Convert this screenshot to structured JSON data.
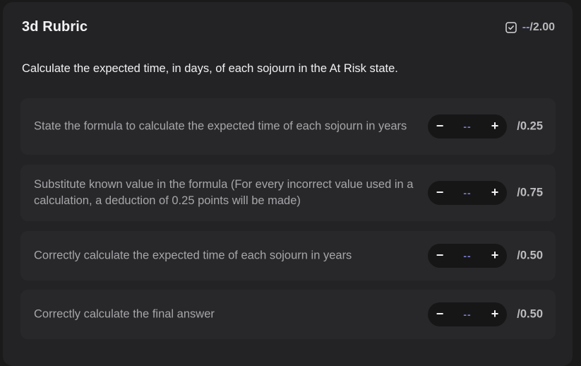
{
  "header": {
    "title": "3d Rubric",
    "score_dash": "--",
    "score_total": "/2.00"
  },
  "question": "Calculate the expected time, in days, of each sojourn in the At Risk state.",
  "items": [
    {
      "text": "State the formula to calculate the expected time of each sojourn in years",
      "value": "--",
      "max": "/0.25"
    },
    {
      "text": "Substitute known value in the formula (For every incorrect value used in a calculation, a deduction of 0.25 points will be made)",
      "value": "--",
      "max": "/0.75"
    },
    {
      "text": "Correctly calculate the expected time of each sojourn in years",
      "value": "--",
      "max": "/0.50"
    },
    {
      "text": "Correctly calculate the final answer",
      "value": "--",
      "max": "/0.50"
    }
  ],
  "stepper": {
    "minus": "−",
    "plus": "+"
  },
  "icons": {
    "summary": "checkbox-icon"
  },
  "colors": {
    "background": "#1a1a1b",
    "panel": "#232325",
    "item": "#28282a",
    "accent_dash": "#8f8fd8"
  }
}
